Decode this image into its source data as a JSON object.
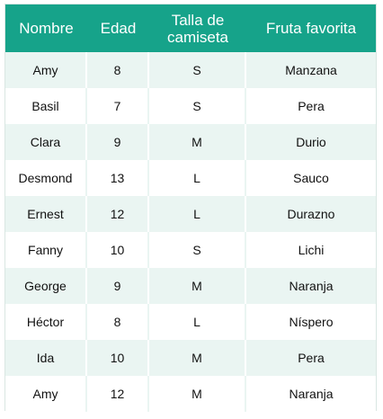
{
  "table": {
    "headers": [
      "Nombre",
      "Edad",
      "Talla de camiseta",
      "Fruta favorita"
    ],
    "rows": [
      [
        "Amy",
        "8",
        "S",
        "Manzana"
      ],
      [
        "Basil",
        "7",
        "S",
        "Pera"
      ],
      [
        "Clara",
        "9",
        "M",
        "Durio"
      ],
      [
        "Desmond",
        "13",
        "L",
        "Sauco"
      ],
      [
        "Ernest",
        "12",
        "L",
        "Durazno"
      ],
      [
        "Fanny",
        "10",
        "S",
        "Lichi"
      ],
      [
        "George",
        "9",
        "M",
        "Naranja"
      ],
      [
        "Héctor",
        "8",
        "L",
        "Níspero"
      ],
      [
        "Ida",
        "10",
        "M",
        "Pera"
      ],
      [
        "Amy",
        "12",
        "M",
        "Naranja"
      ]
    ]
  },
  "colors": {
    "header_bg": "#16a38a",
    "row_stripe": "#eaf5f2"
  }
}
